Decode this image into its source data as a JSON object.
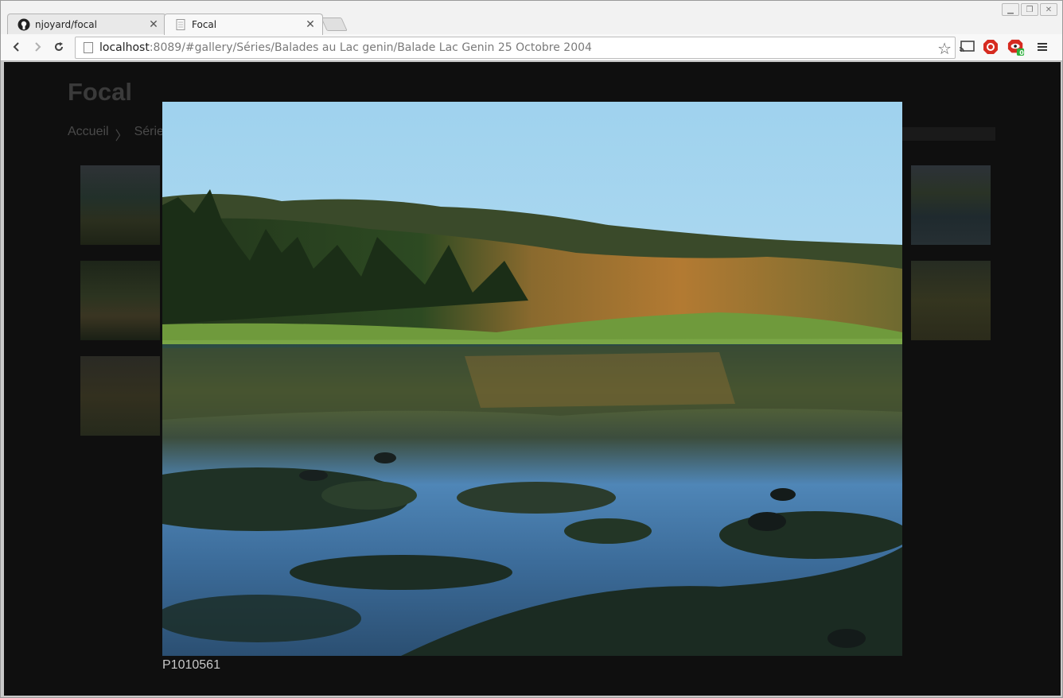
{
  "browser": {
    "tabs": [
      {
        "title": "njoyard/focal",
        "icon": "github-icon"
      },
      {
        "title": "Focal",
        "icon": "page-icon"
      }
    ],
    "url_host": "localhost",
    "url_rest": ":8089/#gallery/Séries/Balades au Lac genin/Balade Lac Genin 25 Octobre 2004",
    "extensions": [
      "cast-icon",
      "adblock-icon",
      "privacy-badge-icon"
    ],
    "extension_badge": "0"
  },
  "site": {
    "title": "Focal",
    "breadcrumb": [
      "Accueil",
      "〉",
      "Séries"
    ]
  },
  "lightbox": {
    "caption": "P1010561"
  }
}
